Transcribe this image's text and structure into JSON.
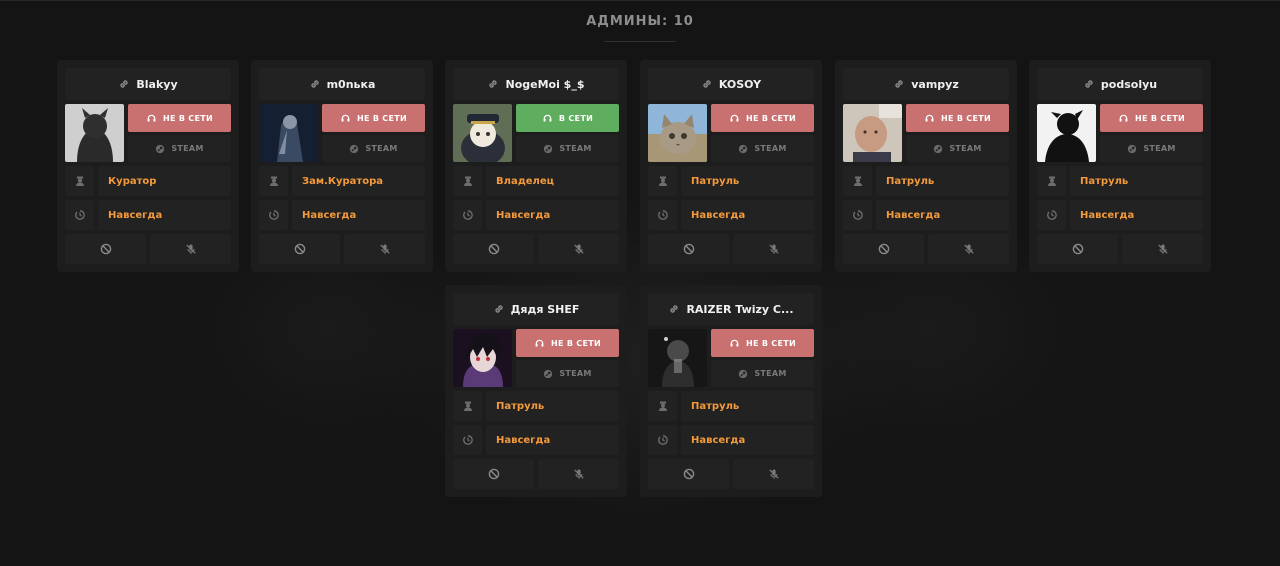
{
  "header": {
    "title": "АДМИНЫ: 10"
  },
  "labels": {
    "steam": "STEAM"
  },
  "colors": {
    "offline": "#c97070",
    "online": "#5fae5f",
    "accent": "#f39a3c"
  },
  "admins": [
    {
      "name": "Blakyy",
      "status": "НЕ В СЕТИ",
      "online": false,
      "role": "Куратор",
      "term": "Навсегда"
    },
    {
      "name": "m0nька",
      "status": "НЕ В СЕТИ",
      "online": false,
      "role": "Зам.Куратора",
      "term": "Навсегда"
    },
    {
      "name": "NogeMoi $_$",
      "status": "В СЕТИ",
      "online": true,
      "role": "Владелец",
      "term": "Навсегда"
    },
    {
      "name": "KOSOY",
      "status": "НЕ В СЕТИ",
      "online": false,
      "role": "Патруль",
      "term": "Навсегда"
    },
    {
      "name": "vampyz",
      "status": "НЕ В СЕТИ",
      "online": false,
      "role": "Патруль",
      "term": "Навсегда"
    },
    {
      "name": "podsolyu",
      "status": "НЕ В СЕТИ",
      "online": false,
      "role": "Патруль",
      "term": "Навсегда"
    },
    {
      "name": "Дядя SHEF",
      "status": "НЕ В СЕТИ",
      "online": false,
      "role": "Патруль",
      "term": "Навсегда"
    },
    {
      "name": "RAIZER Twizy C...",
      "status": "НЕ В СЕТИ",
      "online": false,
      "role": "Патруль",
      "term": "Навсегда"
    }
  ]
}
